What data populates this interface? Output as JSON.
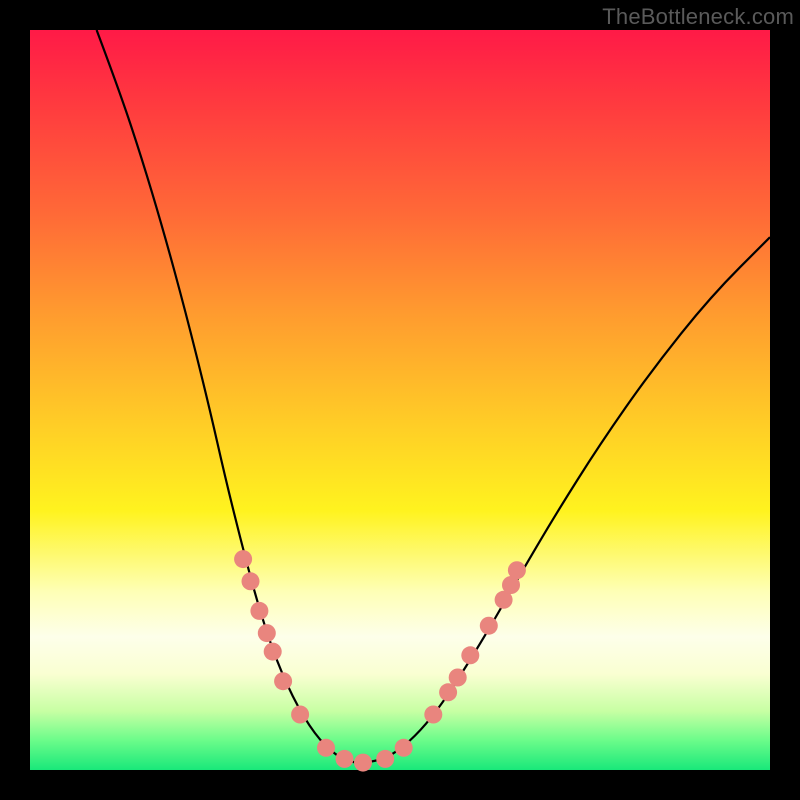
{
  "watermark": "TheBottleneck.com",
  "chart_data": {
    "type": "line",
    "title": "",
    "xlabel": "",
    "ylabel": "",
    "xlim": [
      0,
      100
    ],
    "ylim": [
      0,
      100
    ],
    "comment": "Axes are unlabeled; values are relative pixel-space percentages inside the gradient plot area (0,0 = top-left). The black curve is a V-shaped profile with its minimum near x≈42–48 at the bottom edge. Pink dots cluster on both flanks in the lower ~25%.",
    "series": [
      {
        "name": "curve",
        "kind": "line",
        "points": [
          {
            "x": 9.0,
            "y": 0.0
          },
          {
            "x": 12.0,
            "y": 8.0
          },
          {
            "x": 15.0,
            "y": 17.0
          },
          {
            "x": 18.0,
            "y": 27.0
          },
          {
            "x": 21.0,
            "y": 38.0
          },
          {
            "x": 24.0,
            "y": 50.0
          },
          {
            "x": 26.5,
            "y": 61.0
          },
          {
            "x": 29.0,
            "y": 71.0
          },
          {
            "x": 31.5,
            "y": 80.0
          },
          {
            "x": 34.0,
            "y": 87.0
          },
          {
            "x": 37.0,
            "y": 93.0
          },
          {
            "x": 40.0,
            "y": 97.0
          },
          {
            "x": 43.0,
            "y": 99.0
          },
          {
            "x": 46.0,
            "y": 99.0
          },
          {
            "x": 49.0,
            "y": 98.0
          },
          {
            "x": 52.0,
            "y": 95.5
          },
          {
            "x": 55.0,
            "y": 92.0
          },
          {
            "x": 58.0,
            "y": 87.5
          },
          {
            "x": 62.0,
            "y": 81.0
          },
          {
            "x": 66.0,
            "y": 74.0
          },
          {
            "x": 71.0,
            "y": 65.5
          },
          {
            "x": 77.0,
            "y": 56.0
          },
          {
            "x": 84.0,
            "y": 46.0
          },
          {
            "x": 92.0,
            "y": 36.0
          },
          {
            "x": 100.0,
            "y": 28.0
          }
        ]
      },
      {
        "name": "dots-left",
        "kind": "scatter",
        "points": [
          {
            "x": 28.8,
            "y": 71.5
          },
          {
            "x": 29.8,
            "y": 74.5
          },
          {
            "x": 31.0,
            "y": 78.5
          },
          {
            "x": 32.0,
            "y": 81.5
          },
          {
            "x": 32.8,
            "y": 84.0
          },
          {
            "x": 34.2,
            "y": 88.0
          },
          {
            "x": 36.5,
            "y": 92.5
          },
          {
            "x": 40.0,
            "y": 97.0
          },
          {
            "x": 42.5,
            "y": 98.5
          },
          {
            "x": 45.0,
            "y": 99.0
          }
        ]
      },
      {
        "name": "dots-right",
        "kind": "scatter",
        "points": [
          {
            "x": 48.0,
            "y": 98.5
          },
          {
            "x": 50.5,
            "y": 97.0
          },
          {
            "x": 54.5,
            "y": 92.5
          },
          {
            "x": 56.5,
            "y": 89.5
          },
          {
            "x": 57.8,
            "y": 87.5
          },
          {
            "x": 59.5,
            "y": 84.5
          },
          {
            "x": 62.0,
            "y": 80.5
          },
          {
            "x": 64.0,
            "y": 77.0
          },
          {
            "x": 65.0,
            "y": 75.0
          },
          {
            "x": 65.8,
            "y": 73.0
          }
        ]
      }
    ],
    "gradient_stops_top_to_bottom": [
      "#ff1a47",
      "#ff3a3f",
      "#ff6a37",
      "#ff9a2f",
      "#ffc927",
      "#fff31f",
      "#feffb7",
      "#fdffea",
      "#c8ffa4",
      "#6bfc8a",
      "#19e87a"
    ],
    "dot_color": "#e9857e",
    "curve_color": "#000000"
  }
}
